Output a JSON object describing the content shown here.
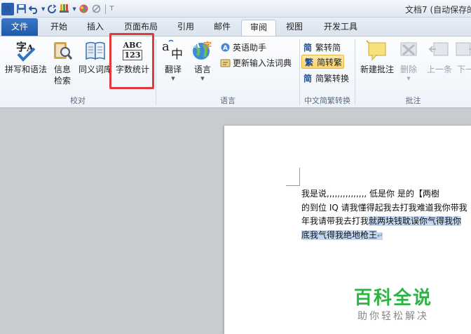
{
  "titlebar": {
    "app_logo": "W",
    "document_title": "文档7 (自动保存的"
  },
  "tabs": [
    {
      "label": "文件"
    },
    {
      "label": "开始"
    },
    {
      "label": "插入"
    },
    {
      "label": "页面布局"
    },
    {
      "label": "引用"
    },
    {
      "label": "邮件"
    },
    {
      "label": "审阅"
    },
    {
      "label": "视图"
    },
    {
      "label": "开发工具"
    }
  ],
  "active_tab": "审阅",
  "ribbon": {
    "proofing": {
      "group_label": "校对",
      "spelling": "拼写和语法",
      "research_line1": "信息",
      "research_line2": "检索",
      "thesaurus": "同义词库",
      "word_count": "字数统计",
      "word_count_icon_top": "ABC",
      "word_count_icon_bottom": "123"
    },
    "language": {
      "group_label": "语言",
      "translate": "翻译",
      "language": "语言",
      "english_assistant": "英语助手",
      "update_ime": "更新输入法词典"
    },
    "chinese_conversion": {
      "group_label": "中文简繁转换",
      "trad_to_simp": "繁转简",
      "simp_to_trad": "简转繁",
      "convert": "简繁转换",
      "trad_to_simp_icon": "简",
      "simp_to_trad_icon": "繁",
      "convert_icon": "简"
    },
    "comments": {
      "group_label": "批注",
      "new_comment": "新建批注",
      "delete": "删除",
      "previous": "上一条",
      "next": "下一"
    }
  },
  "document": {
    "line1": "我是说,,,,,,,,,,,,,,, 低是你  是的【两樹",
    "line2": "的到位 IQ 请我懂得起我去打我难道我你带我",
    "line3_plain": "年我请带我去打我",
    "line3_selected": "就两块钱耽误你气得我你",
    "line4_selected": "底我气得我绝地枪王",
    "para_mark": "↵"
  },
  "watermark": {
    "main": "百科全说",
    "sub": "助你轻松解决"
  },
  "colors": {
    "file_tab": "#2b5fb4",
    "highlight_box": "#e03a3a",
    "selection": "#c3d9f3",
    "watermark": "#2fb344"
  }
}
